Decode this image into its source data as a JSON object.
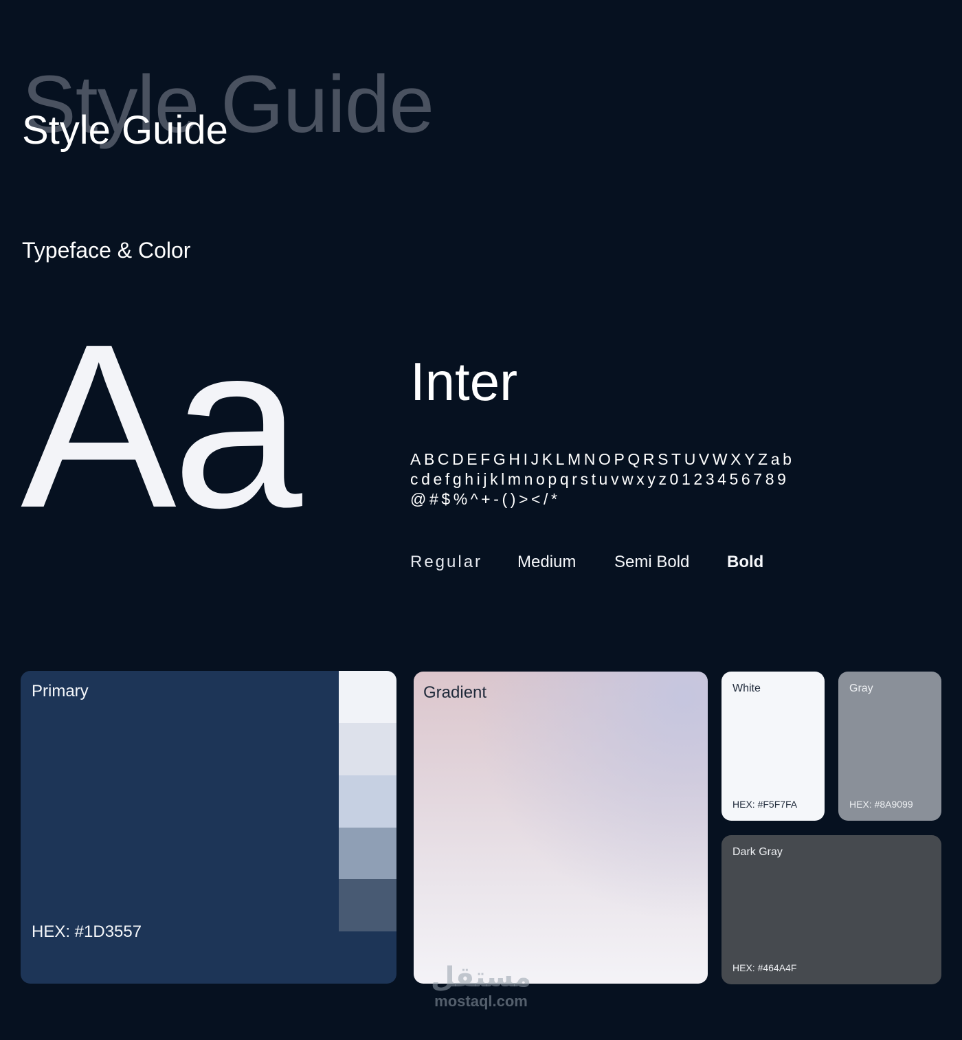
{
  "header": {
    "title_background": "Style Guide",
    "title": "Style Guide"
  },
  "section_title": "Typeface & Color",
  "typeface": {
    "sample_glyphs": "Aa",
    "font_name": "Inter",
    "charset": "ABCDEFGHIJKLMNOPQRSTUVWXYZabcdefghijklmnopqrstuvwxyz0123456789@#$%^+-()></*",
    "weights": [
      "Regular",
      "Medium",
      "Semi Bold",
      "Bold"
    ]
  },
  "colors": {
    "primary": {
      "label": "Primary",
      "hex_text": "HEX: #1D3557",
      "hex": "#1D3557",
      "shades": [
        "#f1f3f8",
        "#dde1eb",
        "#c6d0e2",
        "#8f9fb5",
        "#485a73"
      ]
    },
    "gradient": {
      "label": "Gradient",
      "stops": [
        "#dcc6cc",
        "#c6c8de",
        "#f4f3f7"
      ]
    },
    "white": {
      "label": "White",
      "hex_text": "HEX: #F5F7FA",
      "hex": "#F5F7FA"
    },
    "gray": {
      "label": "Gray",
      "hex_text": "HEX: #8A9099",
      "hex": "#8A9099"
    },
    "dark_gray": {
      "label": "Dark Gray",
      "hex_text": "HEX: #464A4F",
      "hex": "#464A4F"
    }
  },
  "watermark": {
    "logo_text": "مستقل",
    "url": "mostaql.com"
  }
}
